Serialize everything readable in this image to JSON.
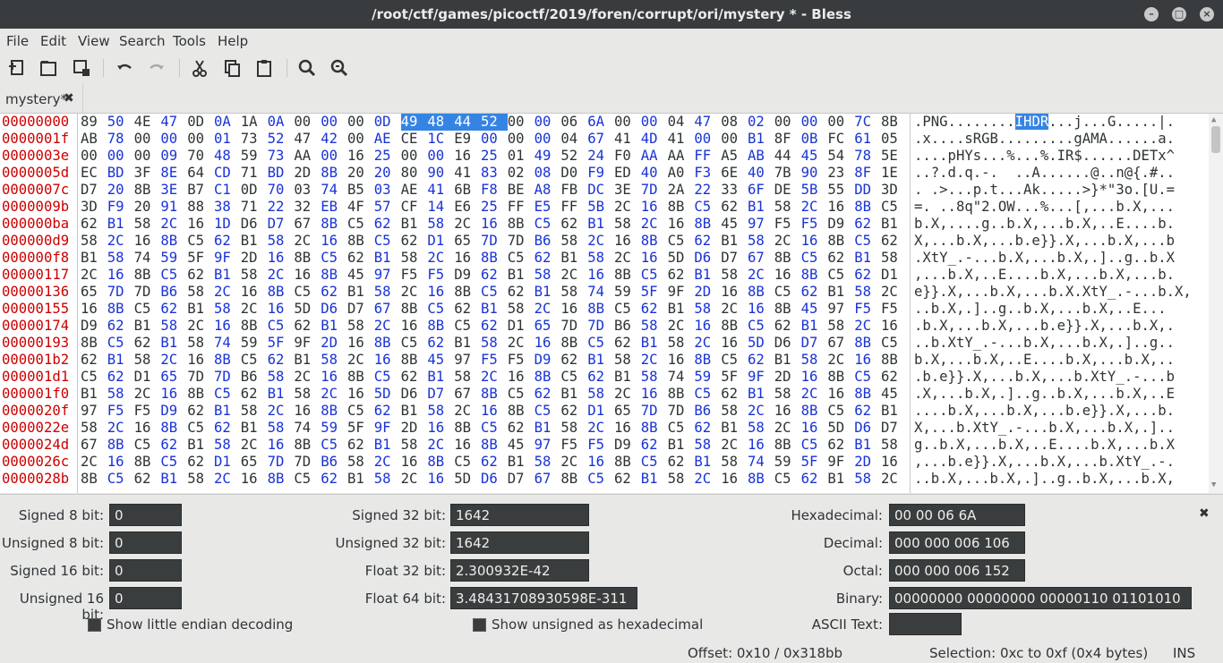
{
  "window": {
    "title": "/root/ctf/games/picoctf/2019/foren/corrupt/ori/mystery * - Bless"
  },
  "menu": [
    "File",
    "Edit",
    "View",
    "Search",
    "Tools",
    "Help"
  ],
  "toolbar": {
    "icons": [
      "new-file-icon",
      "open-file-icon",
      "save-file-icon",
      "undo-icon",
      "redo-icon",
      "cut-icon",
      "copy-icon",
      "paste-icon",
      "find-icon",
      "find-replace-icon"
    ]
  },
  "tab": {
    "label": "mystery*",
    "close": "✖"
  },
  "hex": {
    "offsets": [
      "00000000",
      "0000001f",
      "0000003e",
      "0000005d",
      "0000007c",
      "0000009b",
      "000000ba",
      "000000d9",
      "000000f8",
      "00000117",
      "00000136",
      "00000155",
      "00000174",
      "00000193",
      "000001b2",
      "000001d1",
      "000001f0",
      "0000020f",
      "0000022e",
      "0000024d",
      "0000026c",
      "0000028b"
    ],
    "rows": [
      "89 50 4E 47 0D 0A 1A 0A 00 00 00 0D 49 48 44 52 00 00 06 6A 00 00 04 47 08 02 00 00 00 7C 8B",
      "AB 78 00 00 00 01 73 52 47 42 00 AE CE 1C E9 00 00 00 04 67 41 4D 41 00 00 B1 8F 0B FC 61 05",
      "00 00 00 09 70 48 59 73 AA 00 16 25 00 00 16 25 01 49 52 24 F0 AA AA FF A5 AB 44 45 54 78 5E",
      "EC BD 3F 8E 64 CD 71 BD 2D 8B 20 20 80 90 41 83 02 08 D0 F9 ED 40 A0 F3 6E 40 7B 90 23 8F 1E",
      "D7 20 8B 3E B7 C1 0D 70 03 74 B5 03 AE 41 6B F8 BE A8 FB DC 3E 7D 2A 22 33 6F DE 5B 55 DD 3D",
      "3D F9 20 91 88 38 71 22 32 EB 4F 57 CF 14 E6 25 FF E5 FF 5B 2C 16 8B C5 62 B1 58 2C 16 8B C5",
      "62 B1 58 2C 16 1D D6 D7 67 8B C5 62 B1 58 2C 16 8B C5 62 B1 58 2C 16 8B 45 97 F5 F5 D9 62 B1",
      "58 2C 16 8B C5 62 B1 58 2C 16 8B C5 62 D1 65 7D 7D B6 58 2C 16 8B C5 62 B1 58 2C 16 8B C5 62",
      "B1 58 74 59 5F 9F 2D 16 8B C5 62 B1 58 2C 16 8B C5 62 B1 58 2C 16 5D D6 D7 67 8B C5 62 B1 58",
      "2C 16 8B C5 62 B1 58 2C 16 8B 45 97 F5 F5 D9 62 B1 58 2C 16 8B C5 62 B1 58 2C 16 8B C5 62 D1",
      "65 7D 7D B6 58 2C 16 8B C5 62 B1 58 2C 16 8B C5 62 B1 58 74 59 5F 9F 2D 16 8B C5 62 B1 58 2C",
      "16 8B C5 62 B1 58 2C 16 5D D6 D7 67 8B C5 62 B1 58 2C 16 8B C5 62 B1 58 2C 16 8B 45 97 F5 F5",
      "D9 62 B1 58 2C 16 8B C5 62 B1 58 2C 16 8B C5 62 D1 65 7D 7D B6 58 2C 16 8B C5 62 B1 58 2C 16",
      "8B C5 62 B1 58 74 59 5F 9F 2D 16 8B C5 62 B1 58 2C 16 8B C5 62 B1 58 2C 16 5D D6 D7 67 8B C5",
      "62 B1 58 2C 16 8B C5 62 B1 58 2C 16 8B 45 97 F5 F5 D9 62 B1 58 2C 16 8B C5 62 B1 58 2C 16 8B",
      "C5 62 D1 65 7D 7D B6 58 2C 16 8B C5 62 B1 58 2C 16 8B C5 62 B1 58 74 59 5F 9F 2D 16 8B C5 62",
      "B1 58 2C 16 8B C5 62 B1 58 2C 16 5D D6 D7 67 8B C5 62 B1 58 2C 16 8B C5 62 B1 58 2C 16 8B 45",
      "97 F5 F5 D9 62 B1 58 2C 16 8B C5 62 B1 58 2C 16 8B C5 62 D1 65 7D 7D B6 58 2C 16 8B C5 62 B1",
      "58 2C 16 8B C5 62 B1 58 74 59 5F 9F 2D 16 8B C5 62 B1 58 2C 16 8B C5 62 B1 58 2C 16 5D D6 D7",
      "67 8B C5 62 B1 58 2C 16 8B C5 62 B1 58 2C 16 8B 45 97 F5 F5 D9 62 B1 58 2C 16 8B C5 62 B1 58",
      "2C 16 8B C5 62 D1 65 7D 7D B6 58 2C 16 8B C5 62 B1 58 2C 16 8B C5 62 B1 58 74 59 5F 9F 2D 16",
      "8B C5 62 B1 58 2C 16 8B C5 62 B1 58 2C 16 5D D6 D7 67 8B C5 62 B1 58 2C 16 8B C5 62 B1 58 2C"
    ],
    "ascii": [
      ".PNG........IHDR...j...G.....|.",
      ".x....sRGB.........gAMA......a.",
      "....pHYs...%...%.IR$......DETx^",
      "..?.d.q.-.  ..A......@..n@{.#..",
      ". .>...p.t...Ak.....>}*\"3o.[U.=",
      "=. ..8q\"2.OW...%...[,...b.X,...",
      "b.X,....g..b.X,...b.X,..E....b.",
      "X,...b.X,...b.e}}.X,...b.X,...b",
      ".XtY_.-...b.X,...b.X,.]..g..b.X",
      ",...b.X,..E....b.X,...b.X,...b.",
      "e}}.X,...b.X,...b.X.XtY_.-...b.X,",
      "..b.X,.]..g..b.X,...b.X,..E...",
      ".b.X,...b.X,...b.e}}.X,...b.X,.",
      "..b.XtY_.-...b.X,...b.X,.]..g..",
      "b.X,...b.X,..E....b.X,...b.X,..",
      ".b.e}}.X,...b.X,...b.XtY_.-...b",
      ".X,...b.X,.]..g..b.X,...b.X,..E",
      "....b.X,...b.X,...b.e}}.X,...b.",
      "X,...b.XtY_.-...b.X,...b.X,.]..",
      "g..b.X,...b.X,..E....b.X,...b.X",
      ",...b.e}}.X,...b.X,...b.XtY_.-.",
      "..b.X,...b.X,.]..g..b.X,...b.X,"
    ],
    "selection_ascii": "IHDR"
  },
  "panel": {
    "signed8": {
      "label": "Signed 8 bit:",
      "value": "0"
    },
    "unsigned8": {
      "label": "Unsigned 8 bit:",
      "value": "0"
    },
    "signed16": {
      "label": "Signed 16 bit:",
      "value": "0"
    },
    "unsigned16": {
      "label": "Unsigned 16 bit:",
      "value": "0"
    },
    "signed32": {
      "label": "Signed 32 bit:",
      "value": "1642"
    },
    "unsigned32": {
      "label": "Unsigned 32 bit:",
      "value": "1642"
    },
    "float32": {
      "label": "Float 32 bit:",
      "value": "2.300932E-42"
    },
    "float64": {
      "label": "Float 64 bit:",
      "value": "3.48431708930598E-311"
    },
    "hexadecimal": {
      "label": "Hexadecimal:",
      "value": "00 00 06 6A"
    },
    "decimal": {
      "label": "Decimal:",
      "value": "000 000 006 106"
    },
    "octal": {
      "label": "Octal:",
      "value": "000 000 006 152"
    },
    "binary": {
      "label": "Binary:",
      "value": "00000000 00000000 00000110 01101010"
    },
    "ascii": {
      "label": "ASCII Text:",
      "value": ""
    },
    "little_endian": "Show little endian decoding",
    "unsigned_hex": "Show unsigned as hexadecimal",
    "close": "✖"
  },
  "status": {
    "offset": "Offset: 0x10 / 0x318bb",
    "selection": "Selection: 0xc to 0xf (0x4 bytes)",
    "mode": "INS"
  }
}
